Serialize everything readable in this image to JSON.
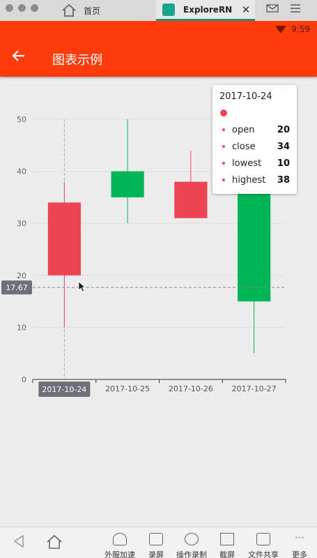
{
  "browser": {
    "tabs": [
      {
        "label": "首页",
        "icon": "home-icon"
      },
      {
        "label": "ExploreRN",
        "icon": "android-app-icon",
        "close_label": "✕"
      }
    ]
  },
  "statusbar": {
    "time": "9:59"
  },
  "appbar": {
    "title": "图表示例",
    "back_icon": "back-arrow-icon"
  },
  "colors": {
    "accent": "#ff3d0a",
    "increase": "#00b457",
    "decrease": "#ec4452"
  },
  "chart_data": {
    "type": "candlestick",
    "categories": [
      "2017-10-24",
      "2017-10-25",
      "2017-10-26",
      "2017-10-27"
    ],
    "series": [
      {
        "open": 20,
        "close": 34,
        "lowest": 10,
        "highest": 38
      },
      {
        "open": 40,
        "close": 35,
        "lowest": 30,
        "highest": 50
      },
      {
        "open": 31,
        "close": 38,
        "lowest": 33,
        "highest": 44
      },
      {
        "open": 38,
        "close": 15,
        "lowest": 5,
        "highest": 42
      }
    ],
    "yticks": [
      0,
      10,
      20,
      30,
      40,
      50
    ],
    "ylim": [
      0,
      50
    ],
    "grid": true,
    "crosshair": {
      "category": "2017-10-24",
      "y_value": "17.67"
    }
  },
  "tooltip": {
    "date": "2017-10-24",
    "rows": [
      {
        "key": "open",
        "value": "20"
      },
      {
        "key": "close",
        "value": "34"
      },
      {
        "key": "lowest",
        "value": "10"
      },
      {
        "key": "highest",
        "value": "38"
      }
    ]
  },
  "toolbar": {
    "items": [
      {
        "label": "外服加速",
        "icon": "rocket-icon"
      },
      {
        "label": "录屏",
        "icon": "camera-icon"
      },
      {
        "label": "操作录制",
        "icon": "record-icon"
      },
      {
        "label": "截屏",
        "icon": "crop-icon"
      },
      {
        "label": "文件共享",
        "icon": "folder-icon"
      },
      {
        "label": "更多",
        "icon": "more-icon"
      }
    ]
  }
}
